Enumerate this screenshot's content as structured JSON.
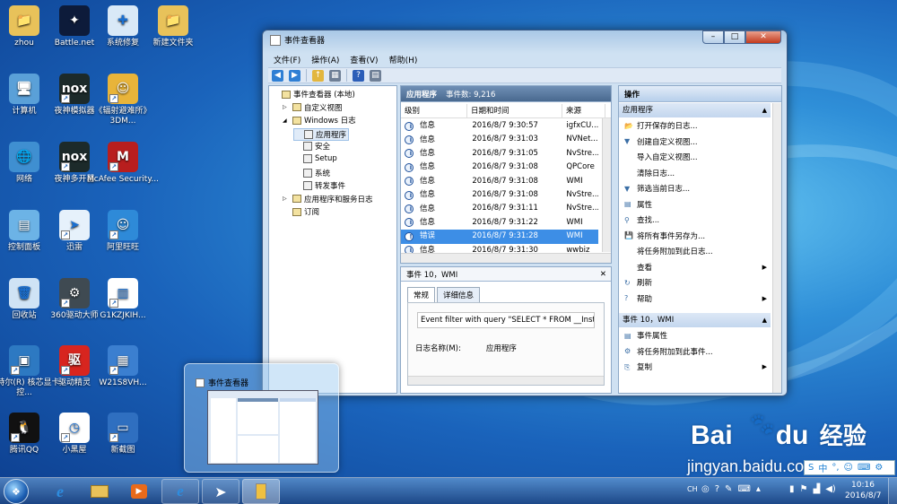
{
  "desktop": {
    "icons": [
      {
        "label": "zhou",
        "color": "#e8c25a",
        "glyph": "📁",
        "shortcut": false
      },
      {
        "label": "Battle.net",
        "color": "#0d1b3a",
        "glyph": "✦",
        "shortcut": false
      },
      {
        "label": "系统修复",
        "color": "#d9e9f7",
        "glyph": "✚",
        "shortcut": false
      },
      {
        "label": "新建文件夹",
        "color": "#e8c25a",
        "glyph": "📁",
        "shortcut": false
      },
      {
        "label": "计算机",
        "color": "#5aa0d8",
        "glyph": "🖥",
        "shortcut": false
      },
      {
        "label": "夜神模拟器",
        "color": "#1c2a2a",
        "glyph": "nox",
        "shortcut": true
      },
      {
        "label": "《辐射避难所》3DM...",
        "color": "#e8b43a",
        "glyph": "☺",
        "shortcut": true
      },
      {
        "label": "网络",
        "color": "#3f8fd1",
        "glyph": "🌐",
        "shortcut": false
      },
      {
        "label": "夜神多开器",
        "color": "#1c2a2a",
        "glyph": "nox",
        "shortcut": true
      },
      {
        "label": "McAfee Security...",
        "color": "#b81e1e",
        "glyph": "M",
        "shortcut": true
      },
      {
        "label": "控制面板",
        "color": "#6cb3e6",
        "glyph": "▤",
        "shortcut": false
      },
      {
        "label": "迅雷",
        "color": "#e6f1fb",
        "glyph": "➤",
        "shortcut": true
      },
      {
        "label": "阿里旺旺",
        "color": "#2e8ad8",
        "glyph": "☺",
        "shortcut": true
      },
      {
        "label": "回收站",
        "color": "#cfe3f5",
        "glyph": "🗑",
        "shortcut": false
      },
      {
        "label": "360驱动大师",
        "color": "#3f4a52",
        "glyph": "⚙",
        "shortcut": true
      },
      {
        "label": "G1KZJKIH...",
        "color": "#ffffff",
        "glyph": "▥",
        "shortcut": true
      },
      {
        "label": "英特尔(R) 核芯显卡控...",
        "color": "#2d79c2",
        "glyph": "▣",
        "shortcut": true
      },
      {
        "label": "驱动精灵",
        "color": "#d7251f",
        "glyph": "驱",
        "shortcut": true
      },
      {
        "label": "W21S8VH...",
        "color": "#3b7fd0",
        "glyph": "▦",
        "shortcut": true
      },
      {
        "label": "腾讯QQ",
        "color": "#111111",
        "glyph": "🐧",
        "shortcut": true
      },
      {
        "label": "小黑屋",
        "color": "#ffffff",
        "glyph": "◷",
        "shortcut": true
      },
      {
        "label": "新截图",
        "color": "#2f6fc0",
        "glyph": "▭",
        "shortcut": true
      }
    ]
  },
  "window": {
    "title": "事件查看器",
    "controls": {
      "minimize": "–",
      "maximize": "□",
      "close": "✕"
    },
    "menu": [
      "文件(F)",
      "操作(A)",
      "查看(V)",
      "帮助(H)"
    ],
    "tree": [
      {
        "label": "事件查看器 (本地)",
        "level": 0,
        "exp": ""
      },
      {
        "label": "自定义视图",
        "level": 1,
        "exp": "▷"
      },
      {
        "label": "Windows 日志",
        "level": 1,
        "exp": "◢"
      },
      {
        "label": "应用程序",
        "level": 2,
        "exp": "",
        "selected": true
      },
      {
        "label": "安全",
        "level": 2,
        "exp": ""
      },
      {
        "label": "Setup",
        "level": 2,
        "exp": ""
      },
      {
        "label": "系统",
        "level": 2,
        "exp": ""
      },
      {
        "label": "转发事件",
        "level": 2,
        "exp": ""
      },
      {
        "label": "应用程序和服务日志",
        "level": 1,
        "exp": "▷"
      },
      {
        "label": "订阅",
        "level": 1,
        "exp": ""
      }
    ],
    "list": {
      "title": "应用程序",
      "count_label": "事件数: 9,216",
      "columns": [
        "级别",
        "日期和时间",
        "来源"
      ],
      "rows": [
        {
          "level": "信息",
          "datetime": "2016/8/7 9:30:57",
          "source": "igfxCU..."
        },
        {
          "level": "信息",
          "datetime": "2016/8/7 9:31:03",
          "source": "NVNet..."
        },
        {
          "level": "信息",
          "datetime": "2016/8/7 9:31:05",
          "source": "NvStre..."
        },
        {
          "level": "信息",
          "datetime": "2016/8/7 9:31:08",
          "source": "QPCore"
        },
        {
          "level": "信息",
          "datetime": "2016/8/7 9:31:08",
          "source": "WMI"
        },
        {
          "level": "信息",
          "datetime": "2016/8/7 9:31:08",
          "source": "NvStre..."
        },
        {
          "level": "信息",
          "datetime": "2016/8/7 9:31:11",
          "source": "NvStre..."
        },
        {
          "level": "信息",
          "datetime": "2016/8/7 9:31:22",
          "source": "WMI"
        },
        {
          "level": "错误",
          "datetime": "2016/8/7 9:31:28",
          "source": "WMI",
          "selected": true
        },
        {
          "level": "信息",
          "datetime": "2016/8/7 9:31:30",
          "source": "wwbiz"
        }
      ]
    },
    "detail": {
      "title": "事件 10，WMI",
      "close": "✕",
      "tabs": [
        "常规",
        "详细信息"
      ],
      "text": "Event filter with query \"SELECT * FROM __Insta",
      "log_name_label": "日志名称(M):",
      "log_name_value": "应用程序"
    },
    "actions": {
      "header": "操作",
      "section1": "应用程序",
      "items1": [
        {
          "label": "打开保存的日志...",
          "icon": "📂",
          "sub": false
        },
        {
          "label": "创建自定义视图...",
          "icon": "▼",
          "sub": false
        },
        {
          "label": "导入自定义视图...",
          "icon": "",
          "sub": false
        },
        {
          "label": "清除日志...",
          "icon": "",
          "sub": false
        },
        {
          "label": "筛选当前日志...",
          "icon": "▼",
          "sub": false
        },
        {
          "label": "属性",
          "icon": "▤",
          "sub": false
        },
        {
          "label": "查找...",
          "icon": "⚲",
          "sub": false
        },
        {
          "label": "将所有事件另存为...",
          "icon": "💾",
          "sub": false
        },
        {
          "label": "将任务附加到此日志...",
          "icon": "",
          "sub": false
        },
        {
          "label": "查看",
          "icon": "",
          "sub": true
        },
        {
          "label": "刷新",
          "icon": "↻",
          "sub": false
        },
        {
          "label": "帮助",
          "icon": "?",
          "sub": true
        }
      ],
      "section2": "事件 10，WMI",
      "items2": [
        {
          "label": "事件属性",
          "icon": "▤",
          "sub": false
        },
        {
          "label": "将任务附加到此事件...",
          "icon": "⚙",
          "sub": false
        },
        {
          "label": "复制",
          "icon": "⎘",
          "sub": true
        }
      ]
    }
  },
  "thumbnail": {
    "title": "事件查看器"
  },
  "watermark": {
    "brand": "Bai",
    "brand2": "du",
    "cn": "经验",
    "url": "jingyan.baidu.com"
  },
  "tray": {
    "lang": "CH",
    "time": "10:16",
    "date": "2016/8/7",
    "ime": "中"
  }
}
